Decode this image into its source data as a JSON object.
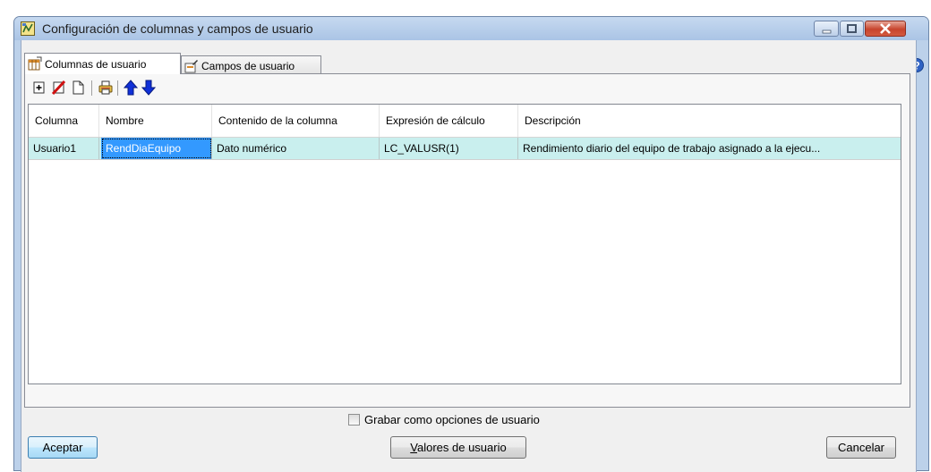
{
  "window": {
    "title": "Configuración de columnas y campos de usuario",
    "controls": [
      "minimize-icon",
      "maximize-icon",
      "close-icon"
    ]
  },
  "tabs": [
    {
      "label": "Columnas de usuario",
      "active": true,
      "icon": "table-edit-icon"
    },
    {
      "label": "Campos de usuario",
      "active": false,
      "icon": "form-edit-icon"
    }
  ],
  "toolbar": {
    "buttons": [
      "add-row-icon",
      "delete-row-icon",
      "copy-icon",
      "print-icon",
      "move-up-icon",
      "move-down-icon"
    ]
  },
  "grid": {
    "columns": [
      "Columna",
      "Nombre",
      "Contenido de la columna",
      "Expresión de cálculo",
      "Descripción"
    ],
    "rows": [
      [
        "Usuario1",
        "RendDiaEquipo",
        "Dato numérico",
        "LC_VALUSR(1)",
        "Rendimiento diario del equipo de trabajo asignado a la ejecu..."
      ]
    ]
  },
  "footer": {
    "checkbox_label": "Grabar como opciones de usuario",
    "checkbox_checked": false,
    "accept_label": "Aceptar",
    "values_label": "Valores de usuario",
    "values_mnemonic": "V",
    "cancel_label": "Cancelar"
  },
  "colors": {
    "selected_row": "#c9efee",
    "selected_cell": "#3399ff",
    "title_bar": "#b9cfeb",
    "close_button": "#c7442d"
  }
}
